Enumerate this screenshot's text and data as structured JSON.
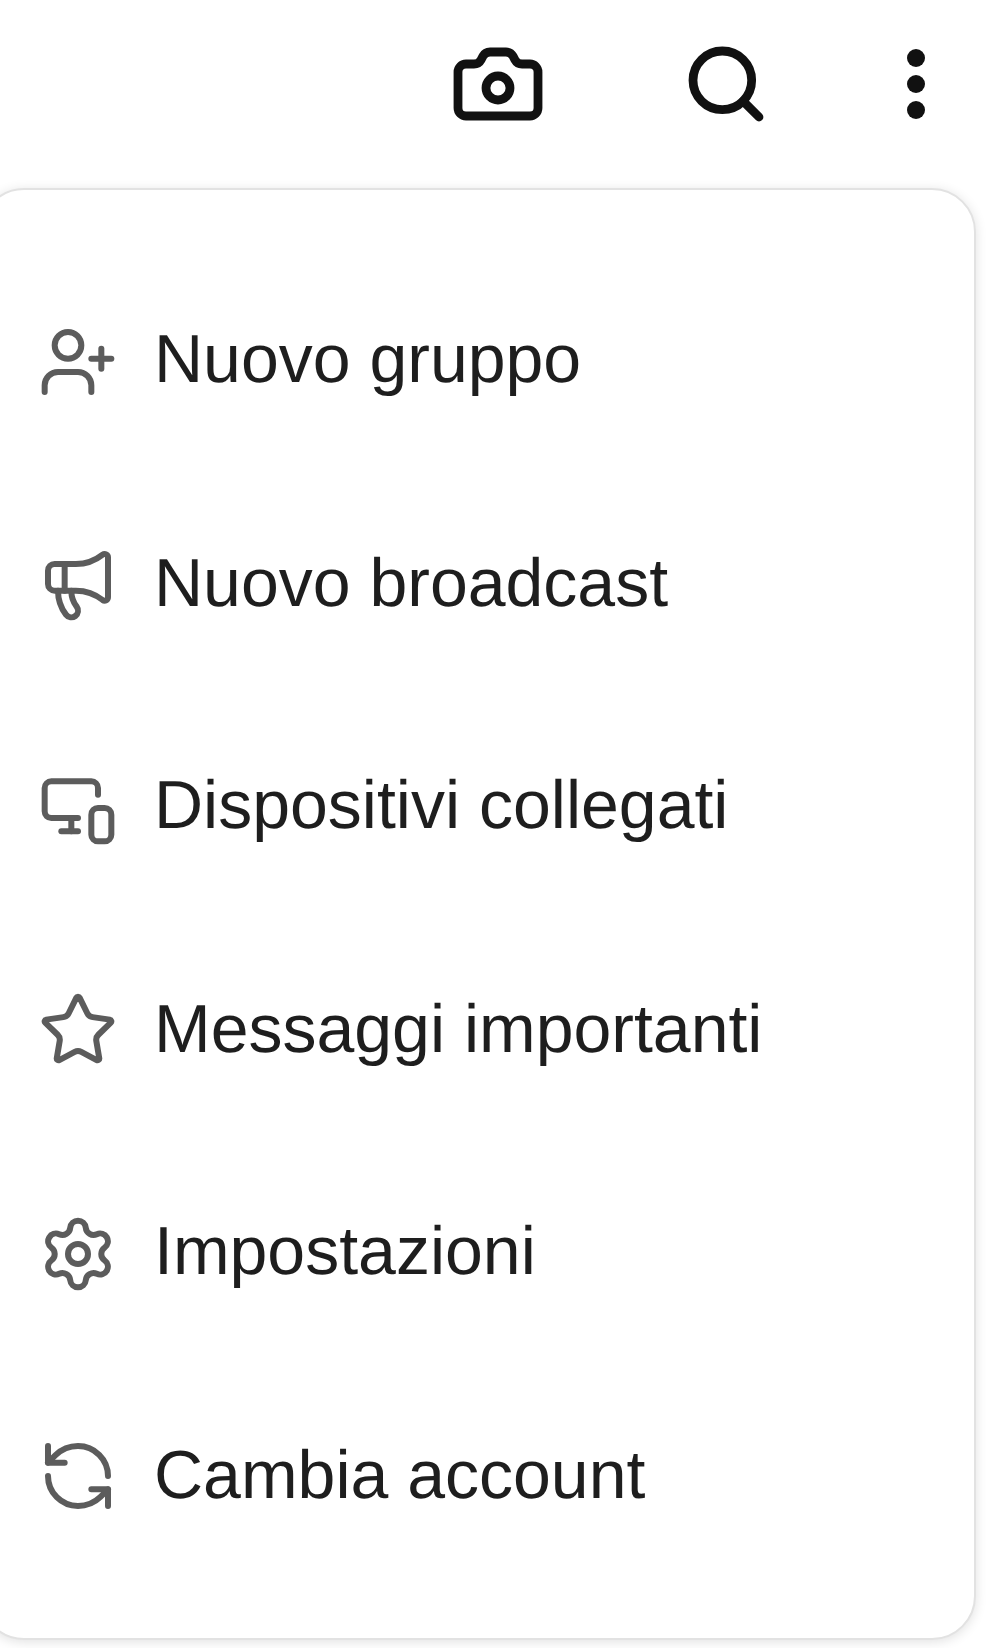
{
  "menu": {
    "items": [
      {
        "label": "Nuovo gruppo"
      },
      {
        "label": "Nuovo broadcast"
      },
      {
        "label": "Dispositivi collegati"
      },
      {
        "label": "Messaggi importanti"
      },
      {
        "label": "Impostazioni"
      },
      {
        "label": "Cambia account"
      }
    ]
  }
}
